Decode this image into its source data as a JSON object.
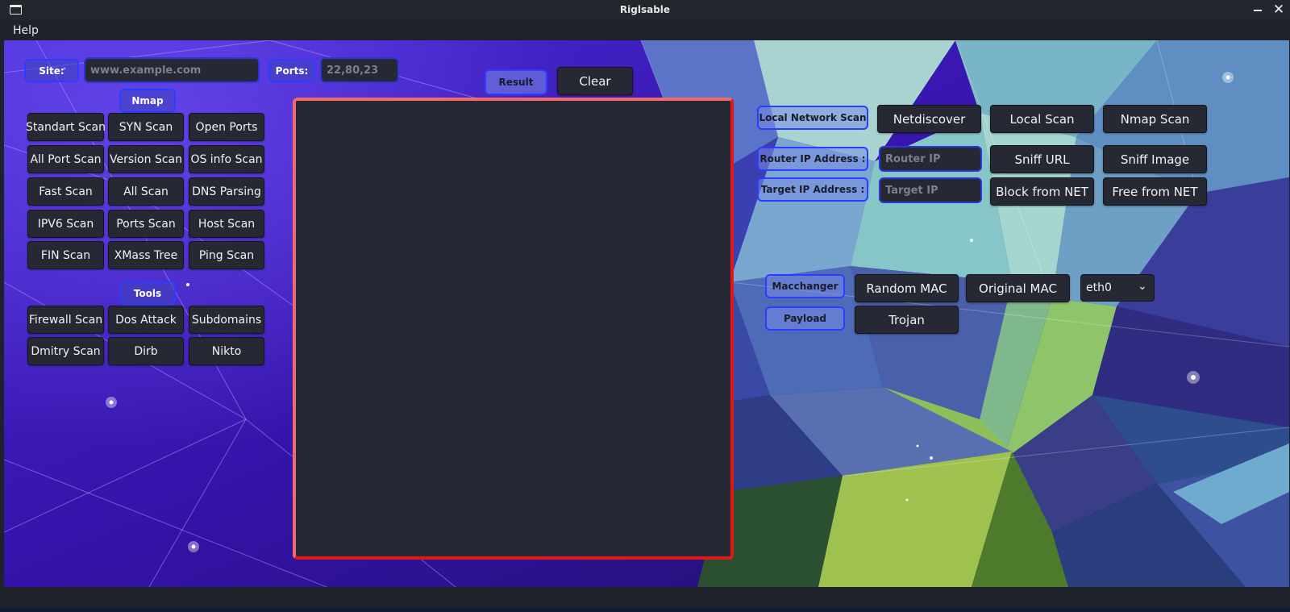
{
  "window": {
    "title": "Riglsable"
  },
  "menu": {
    "help": "Help"
  },
  "site": {
    "label": "Site:",
    "placeholder": "www.example.com"
  },
  "ports": {
    "label": "Ports:",
    "placeholder": "22,80,23"
  },
  "result": {
    "label": "Result",
    "clear": "Clear"
  },
  "nmap": {
    "label": "Nmap",
    "buttons": [
      "Standart Scan",
      "SYN Scan",
      "Open Ports",
      "All Port Scan",
      "Version Scan",
      "OS info Scan",
      "Fast Scan",
      "All Scan",
      "DNS Parsing",
      "IPV6 Scan",
      "Ports Scan",
      "Host Scan",
      "FIN Scan",
      "XMass Tree",
      "Ping Scan"
    ]
  },
  "tools": {
    "label": "Tools",
    "buttons": [
      "Firewall Scan",
      "Dos Attack",
      "Subdomains",
      "Dmitry Scan",
      "Dirb",
      "Nikto"
    ]
  },
  "network": {
    "local_label": "Local Network Scan",
    "netdiscover": "Netdiscover",
    "local_scan": "Local Scan",
    "nmap_scan": "Nmap Scan",
    "router_label": "Router IP Address :",
    "router_placeholder": "Router IP",
    "sniff_url": "Sniff URL",
    "sniff_image": "Sniff Image",
    "target_label": "Target IP Address :",
    "target_placeholder": "Target IP",
    "block": "Block from NET",
    "free": "Free from NET"
  },
  "mac": {
    "label": "Macchanger",
    "random": "Random MAC",
    "original": "Original MAC",
    "interface": "eth0"
  },
  "payload": {
    "label": "Payload",
    "trojan": "Trojan"
  },
  "colors": {
    "frame_red": "#e01818",
    "label_blue": "#2d3cff",
    "button_bg": "#262833",
    "chrome_bg": "#1f222a"
  },
  "icons": {
    "window": "window-icon",
    "minimize": "minimize-icon",
    "close": "close-icon",
    "dropdown": "chevron-down-icon"
  }
}
